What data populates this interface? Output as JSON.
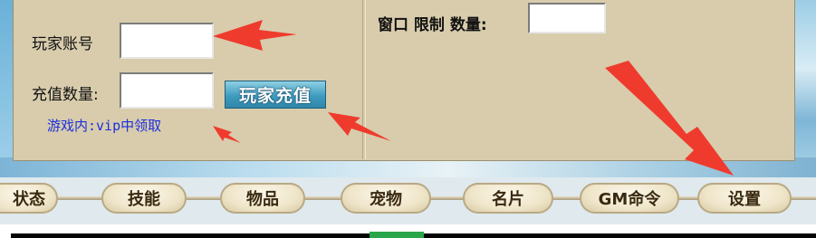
{
  "form": {
    "account_label": "玩家账号",
    "account_value": "",
    "amount_label": "充值数量:",
    "amount_value": "",
    "recharge_button": "玩家充值",
    "hint": "游戏内:vip中领取",
    "window_label": "窗口 限制 数量:",
    "window_value": ""
  },
  "tabs": [
    {
      "label": "状态"
    },
    {
      "label": "技能"
    },
    {
      "label": "物品"
    },
    {
      "label": "宠物"
    },
    {
      "label": "名片"
    },
    {
      "label": "GM命令"
    },
    {
      "label": "设置"
    }
  ],
  "colors": {
    "arrow": "#ef3b2d",
    "hint_text": "#1b2fe0",
    "button": "#3f9cbf"
  }
}
